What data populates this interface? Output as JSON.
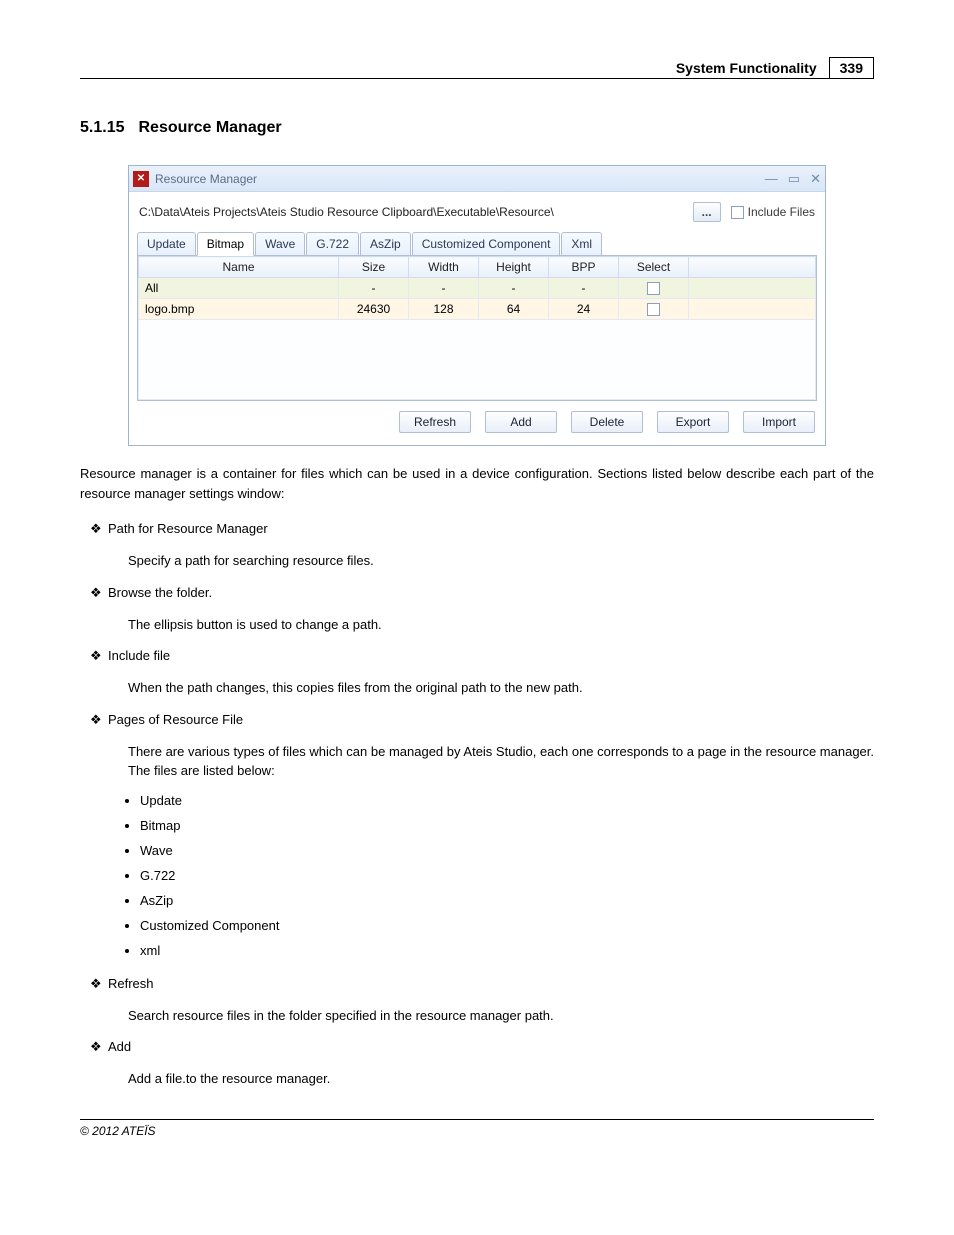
{
  "header": {
    "title": "System Functionality",
    "page": "339"
  },
  "section": {
    "number": "5.1.15",
    "title": "Resource Manager"
  },
  "window": {
    "title": "Resource Manager",
    "path": "C:\\Data\\Ateis Projects\\Ateis Studio Resource Clipboard\\Executable\\Resource\\",
    "browse_label": "...",
    "include_label": "Include Files",
    "tabs": [
      "Update",
      "Bitmap",
      "Wave",
      "G.722",
      "AsZip",
      "Customized Component",
      "Xml"
    ],
    "active_tab_index": 1,
    "columns": [
      "Name",
      "Size",
      "Width",
      "Height",
      "BPP",
      "Select"
    ],
    "rows": [
      {
        "name": "All",
        "size": "-",
        "width": "-",
        "height": "-",
        "bpp": "-",
        "klass": "row-all"
      },
      {
        "name": "logo.bmp",
        "size": "24630",
        "width": "128",
        "height": "64",
        "bpp": "24",
        "klass": "row-data"
      }
    ],
    "buttons": [
      "Refresh",
      "Add",
      "Delete",
      "Export",
      "Import"
    ]
  },
  "intro": "Resource manager is a container for files which can be used in a device configuration. Sections listed below describe each part of the resource manager settings window:",
  "items": [
    {
      "title": "Path for Resource Manager",
      "desc": "Specify a path for searching resource files."
    },
    {
      "title": "Browse the folder.",
      "desc": "The ellipsis button is used to change a path."
    },
    {
      "title": "Include file",
      "desc": "When the path changes, this copies files from the original path to the new path."
    },
    {
      "title": "Pages of Resource File",
      "desc": "There are various types of files which can be managed by Ateis Studio, each one corresponds to a page in the resource manager. The files are listed below:"
    }
  ],
  "pages_list": [
    "Update",
    "Bitmap",
    "Wave",
    "G.722",
    "AsZip",
    "Customized Component",
    "xml"
  ],
  "tail_items": [
    {
      "title": "Refresh",
      "desc": "Search resource files in the folder specified in the resource manager path."
    },
    {
      "title": "Add",
      "desc": "Add a file.to the resource manager."
    }
  ],
  "footer": "© 2012 ATEÏS"
}
